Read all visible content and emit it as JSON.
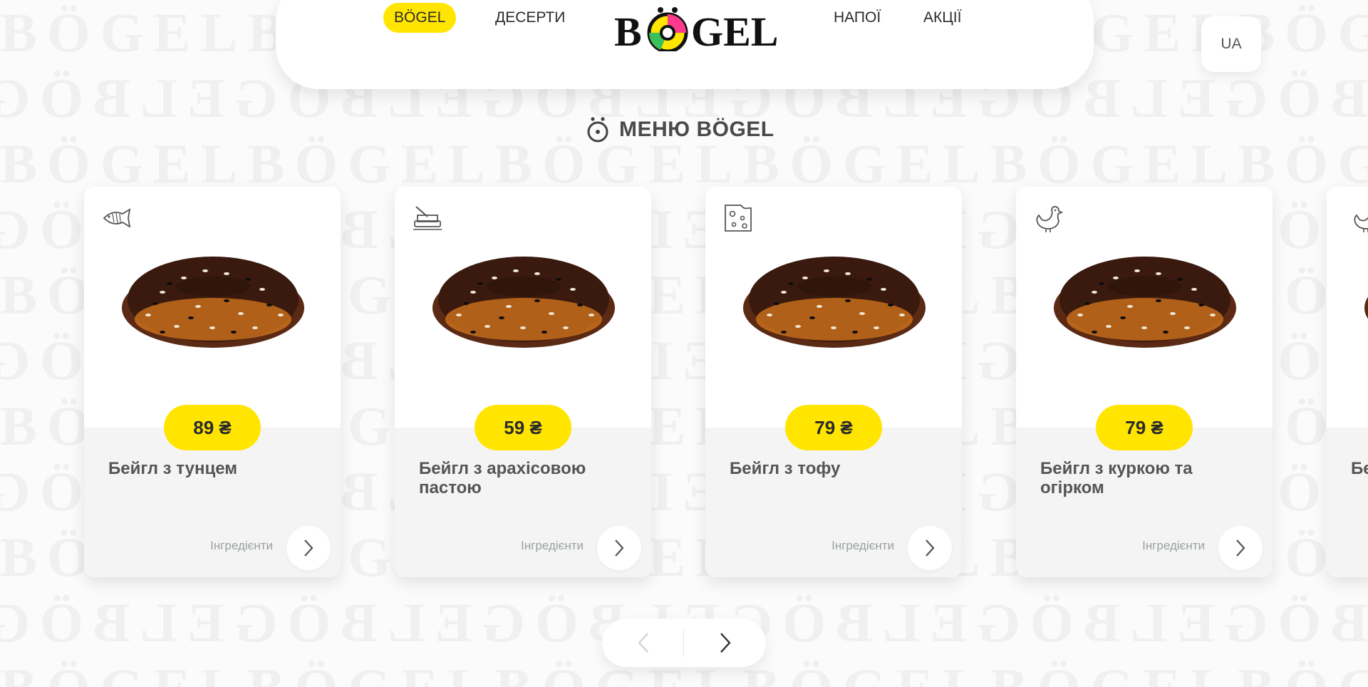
{
  "header": {
    "nav_left": [
      {
        "label": "BÖGEL",
        "active": true
      },
      {
        "label": "Десерти",
        "active": false
      }
    ],
    "logo_text": "BÖGEL",
    "nav_right": [
      {
        "label": "Напої",
        "active": false
      },
      {
        "label": "Акції",
        "active": false
      }
    ],
    "language": "UA"
  },
  "section": {
    "title": "МЕНЮ BÖGEL",
    "icon": "bagel-face-icon"
  },
  "colors": {
    "accent": "#ffe500",
    "text": "#3a3a3a",
    "muted": "#9aa0a0"
  },
  "cards": [
    {
      "icon": "fish-icon",
      "price": "89 ₴",
      "name": "Бейгл з тунцем",
      "ingredients_label": "Інгредієнти"
    },
    {
      "icon": "butter-icon",
      "price": "59 ₴",
      "name": "Бейгл з арахісовою пастою",
      "ingredients_label": "Інгредієнти"
    },
    {
      "icon": "cheese-icon",
      "price": "79 ₴",
      "name": "Бейгл з тофу",
      "ingredients_label": "Інгредієнти"
    },
    {
      "icon": "chicken-icon",
      "price": "79 ₴",
      "name": "Бейгл з куркою та огірком",
      "ingredients_label": "Інгредієнти"
    },
    {
      "icon": "chicken-icon",
      "name_fragment": "Бе"
    }
  ],
  "pager": {
    "prev_enabled": false,
    "next_enabled": true
  }
}
